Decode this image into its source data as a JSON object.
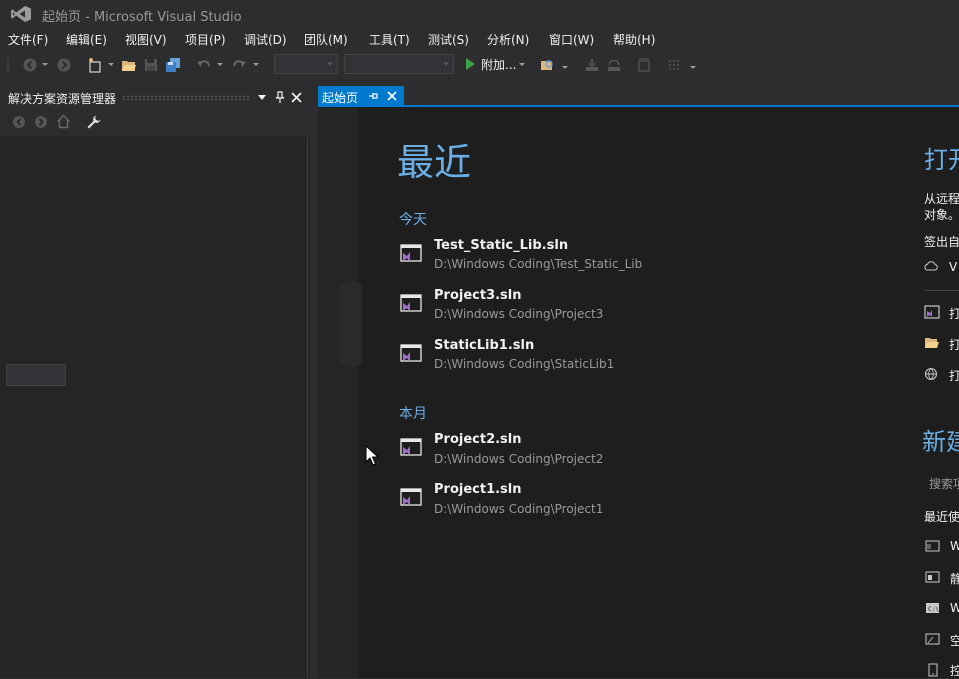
{
  "window": {
    "title": "起始页 - Microsoft Visual Studio"
  },
  "menu": [
    "文件(F)",
    "编辑(E)",
    "视图(V)",
    "项目(P)",
    "调试(D)",
    "团队(M)",
    "工具(T)",
    "测试(S)",
    "分析(N)",
    "窗口(W)",
    "帮助(H)"
  ],
  "toolbar": {
    "attach_label": "附加..."
  },
  "solution_explorer": {
    "title": "解决方案资源管理器"
  },
  "document_tab": {
    "label": "起始页"
  },
  "start_page": {
    "recent_heading": "最近",
    "groups": [
      {
        "label": "今天",
        "items": [
          {
            "name": "Test_Static_Lib.sln",
            "path": "D:\\Windows Coding\\Test_Static_Lib"
          },
          {
            "name": "Project3.sln",
            "path": "D:\\Windows Coding\\Project3"
          },
          {
            "name": "StaticLib1.sln",
            "path": "D:\\Windows Coding\\StaticLib1"
          }
        ]
      },
      {
        "label": "本月",
        "items": [
          {
            "name": "Project2.sln",
            "path": "D:\\Windows Coding\\Project2"
          },
          {
            "name": "Project1.sln",
            "path": "D:\\Windows Coding\\Project1"
          }
        ]
      }
    ],
    "right": {
      "open_heading": "打开",
      "open_desc_1": "从远程",
      "open_desc_2": "对象。",
      "checkout": "签出自",
      "vsts_label": "V",
      "open_item_1": "打",
      "open_item_2": "打",
      "open_item_3": "打",
      "new_heading": "新建",
      "search_placeholder": "搜索项",
      "recent_templates": "最近使",
      "template_1": "W",
      "template_2": "静",
      "template_3": "W",
      "template_4": "空",
      "template_5": "控"
    }
  },
  "colors": {
    "accent": "#007acc",
    "heading": "#6aaee5",
    "background": "#1e1e1e"
  }
}
